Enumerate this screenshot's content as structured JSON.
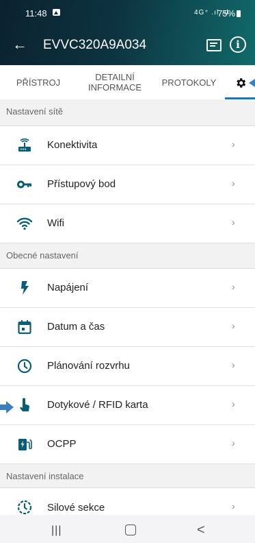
{
  "status_bar": {
    "time": "11:48",
    "network": "4G⁺ .ıl .ıl",
    "battery": "75%"
  },
  "app_bar": {
    "title": "EVVC320A9A034"
  },
  "tabs": [
    {
      "label": "PŘÍSTROJ"
    },
    {
      "label": "DETAILNÍ INFORMACE"
    },
    {
      "label": "PROTOKOLY"
    },
    {
      "label": ""
    }
  ],
  "sections": [
    {
      "title": "Nastavení sítě"
    },
    {
      "title": "Obecné nastavení"
    },
    {
      "title": "Nastavení instalace"
    }
  ],
  "rows": [
    {
      "label": "Konektivita",
      "icon": "router-icon"
    },
    {
      "label": "Přístupový bod",
      "icon": "key-icon"
    },
    {
      "label": "Wifi",
      "icon": "wifi-icon"
    },
    {
      "label": "Napájení",
      "icon": "lightning-icon"
    },
    {
      "label": "Datum a čas",
      "icon": "calendar-icon"
    },
    {
      "label": "Plánování rozvrhu",
      "icon": "clock-icon"
    },
    {
      "label": "Dotykové / RFID karta",
      "icon": "touch-icon"
    },
    {
      "label": "OCPP",
      "icon": "charging-station-icon"
    },
    {
      "label": "Silové sekce",
      "icon": "timer-icon"
    }
  ],
  "chevron": "›",
  "colors": {
    "accent": "#1778b8",
    "icon": "#0a5d77",
    "header_start": "#0b2230",
    "header_end": "#116a6a"
  }
}
